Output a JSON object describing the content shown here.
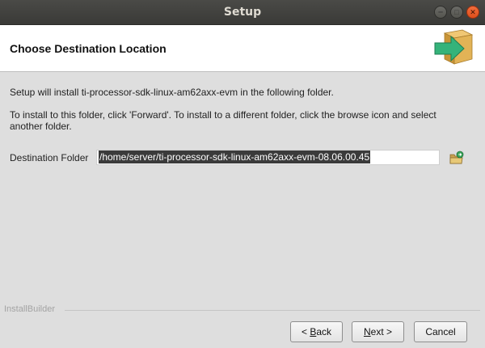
{
  "window": {
    "title": "Setup",
    "controls": {
      "minimize": "–",
      "maximize": "□",
      "close": "✕"
    }
  },
  "header": {
    "title": "Choose Destination Location",
    "icon": "install-box-arrow-icon"
  },
  "content": {
    "line1": "Setup will install ti-processor-sdk-linux-am62axx-evm in the following folder.",
    "line2a": "To install to this folder, click 'Forward'. To install to a different folder, click the browse icon and select",
    "line2b": "another folder.",
    "destination_label": "Destination Folder",
    "destination_value": "/home/server/ti-processor-sdk-linux-am62axx-evm-08.06.00.45",
    "browse_icon": "folder-browse-icon"
  },
  "footer": {
    "brand": "InstallBuilder",
    "buttons": {
      "back": {
        "mnemonic": "B",
        "rest": "ack",
        "prefix": "< "
      },
      "next": {
        "mnemonic": "N",
        "rest": "ext",
        "suffix": " >"
      },
      "cancel": "Cancel"
    }
  },
  "colors": {
    "titlebar": "#3f3f3c",
    "close_button": "#e95420",
    "background": "#dedede",
    "header_bg": "#ffffff",
    "selection": "#3b3b3b",
    "icon_box": "#d9a74a",
    "icon_arrow": "#2eaa6f"
  }
}
